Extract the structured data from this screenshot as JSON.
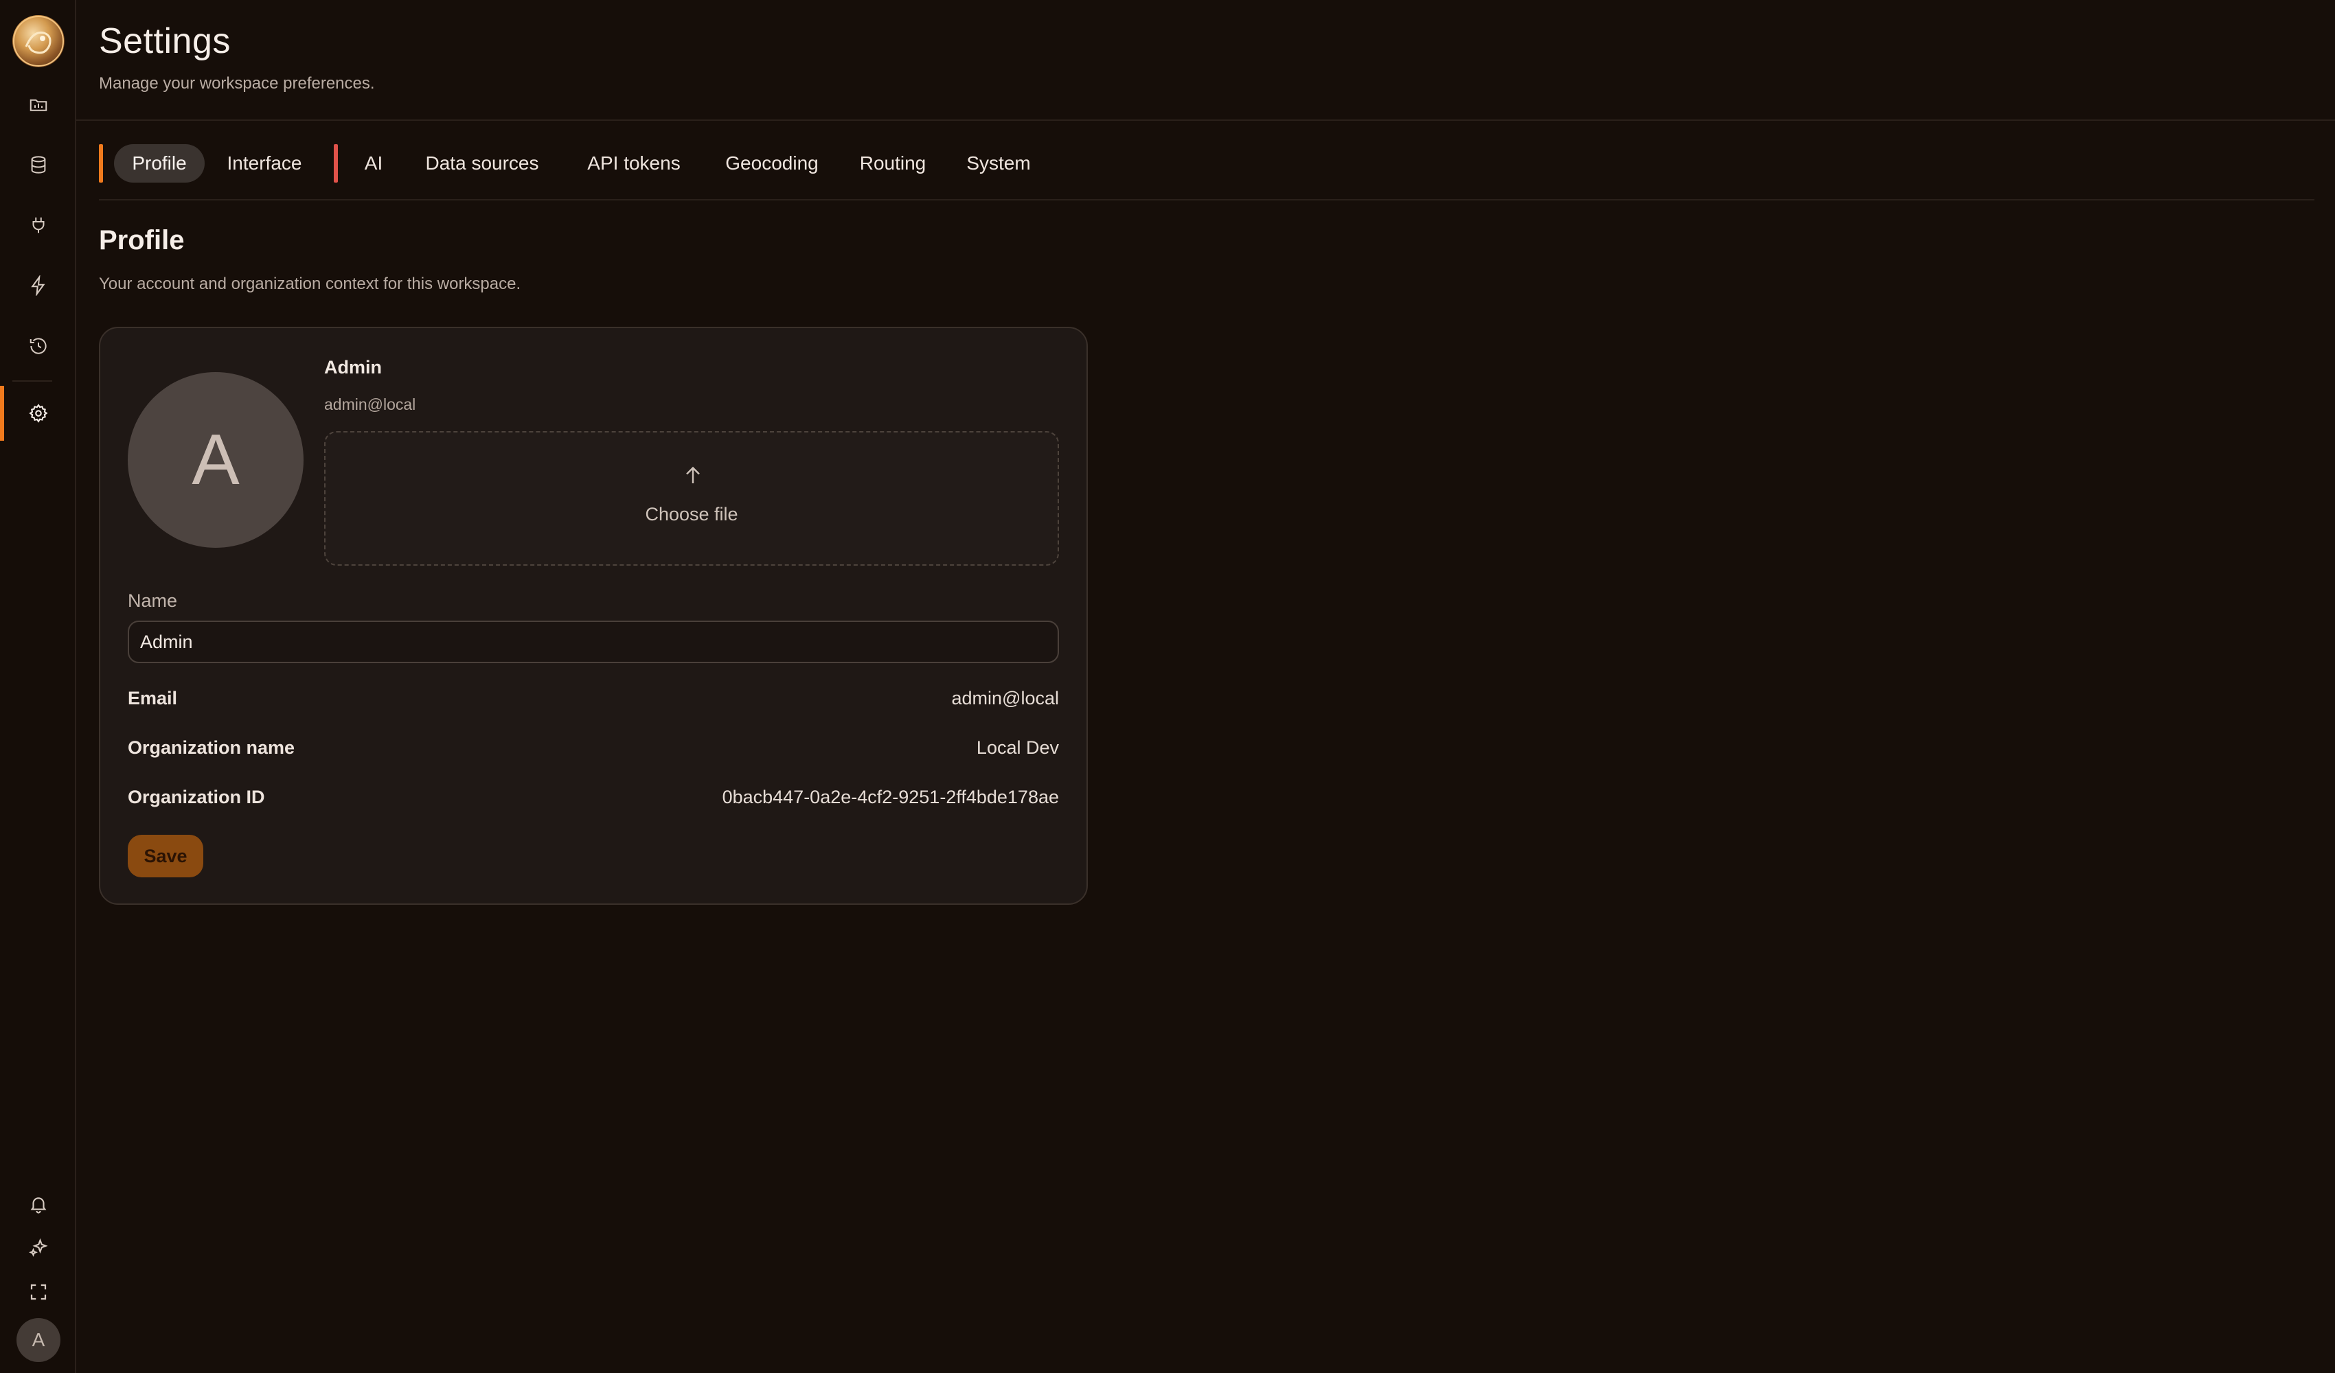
{
  "colors": {
    "accent": "#f07a1d",
    "tab_marker_secondary": "#e0524a",
    "background": "#160e09",
    "card": "#1f1815",
    "save_button": "#8a4a10"
  },
  "sidebar": {
    "items": [
      {
        "icon": "folder-chart-icon"
      },
      {
        "icon": "database-icon"
      },
      {
        "icon": "plug-icon"
      },
      {
        "icon": "lightning-icon"
      },
      {
        "icon": "history-icon"
      },
      {
        "icon": "gear-icon",
        "active": true
      }
    ],
    "bottom": [
      {
        "icon": "bell-icon"
      },
      {
        "icon": "sparkles-icon"
      },
      {
        "icon": "fullscreen-icon"
      }
    ],
    "avatar_initial": "A"
  },
  "header": {
    "title": "Settings",
    "subtitle": "Manage your workspace preferences."
  },
  "tabs": [
    {
      "label": "Profile",
      "active": true
    },
    {
      "label": "Interface"
    },
    {
      "label": "AI"
    },
    {
      "label": "Data sources"
    },
    {
      "label": "API tokens"
    },
    {
      "label": "Geocoding"
    },
    {
      "label": "Routing"
    },
    {
      "label": "System"
    }
  ],
  "section": {
    "title": "Profile",
    "description": "Your account and organization context for this workspace."
  },
  "profile": {
    "avatar_initial": "A",
    "name": "Admin",
    "email": "admin@local",
    "upload_label": "Choose file",
    "name_field_label": "Name",
    "name_field_value": "Admin",
    "rows": [
      {
        "label": "Email",
        "value": "admin@local"
      },
      {
        "label": "Organization name",
        "value": "Local Dev"
      },
      {
        "label": "Organization ID",
        "value": "0bacb447-0a2e-4cf2-9251-2ff4bde178ae"
      }
    ],
    "save_label": "Save"
  }
}
